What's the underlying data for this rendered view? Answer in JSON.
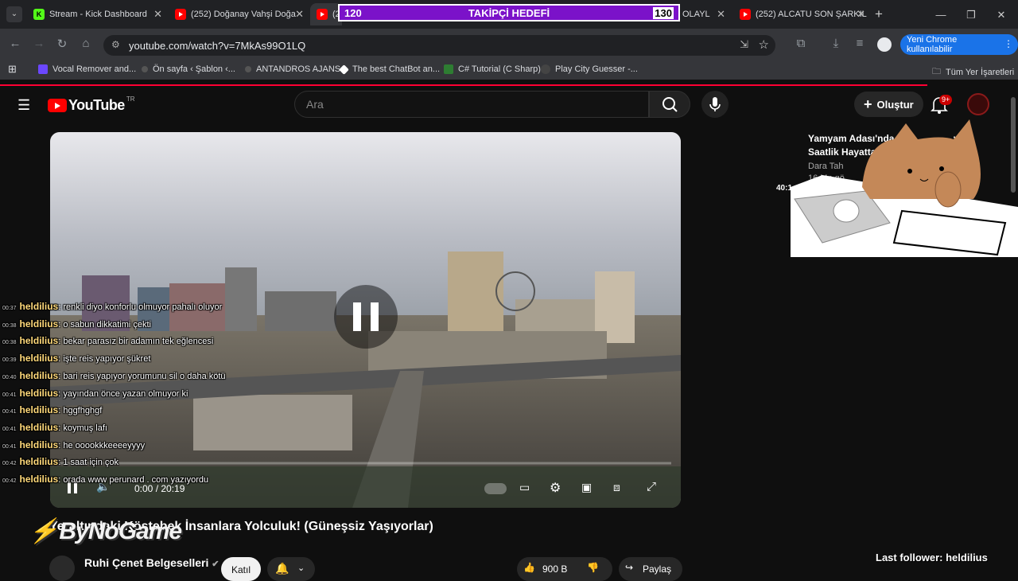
{
  "browser": {
    "tabs": [
      {
        "title": "Stream - Kick Dashboard",
        "icon": "kick-icon"
      },
      {
        "title": "(252) Doğanay Vahşi Doğa",
        "icon": "youtube-icon"
      },
      {
        "title": "(2",
        "icon": "youtube-icon",
        "active": true
      },
      {
        "title": "OLAYL",
        "icon": "youtube-icon"
      },
      {
        "title": "(252) ALCATU SON ŞARKIL",
        "icon": "youtube-icon"
      }
    ],
    "url": "youtube.com/watch?v=7MkAs99O1LQ",
    "profile_button": "Yeni Chrome kullanılabilir",
    "bookmarks": [
      "Vocal Remover and...",
      "Ön sayfa ‹ Şablon ‹...",
      "ANTANDROS AJANS",
      "The best ChatBot an...",
      "C# Tutorial (C Sharp)",
      "Play City Guesser -..."
    ],
    "all_bookmarks": "Tüm Yer İşaretleri"
  },
  "overlay_goal": {
    "label": "TAKİPÇİ HEDEFİ",
    "current": "120",
    "target": "130"
  },
  "youtube": {
    "logo_text": "YouTube",
    "region": "TR",
    "search_placeholder": "Ara",
    "create_label": "Oluştur",
    "notif_badge": "9+"
  },
  "player": {
    "time": "0:00 / 20:19",
    "progress": 0.0
  },
  "chat": [
    {
      "time": "00:37",
      "user": "heldilius",
      "msg": ": renkli diyo konforlu olmuyor pahalı oluyor"
    },
    {
      "time": "00:38",
      "user": "heldilius",
      "msg": ": o sabun dikkatimi çekti"
    },
    {
      "time": "00:38",
      "user": "heldilius",
      "msg": ": bekar parasız bir adamın tek eğlencesi"
    },
    {
      "time": "00:39",
      "user": "heldilius",
      "msg": ": işte reis yapıyor şükret"
    },
    {
      "time": "00:40",
      "user": "heldilius",
      "msg": ": bari reis yapıyor yorumunu sil o daha kötü"
    },
    {
      "time": "00:41",
      "user": "heldilius",
      "msg": ": yayından önce yazan olmuyor ki"
    },
    {
      "time": "00:41",
      "user": "heldilius",
      "msg": ": hggfhghgf"
    },
    {
      "time": "00:41",
      "user": "heldilius",
      "msg": ": koymuş lafı"
    },
    {
      "time": "00:41",
      "user": "heldilius",
      "msg": ": he ooookkkeeeeyyyy"
    },
    {
      "time": "00:42",
      "user": "heldilius",
      "msg": ": 1 saat için çok"
    },
    {
      "time": "00:42",
      "user": "heldilius",
      "msg": ": orada www perunard . com yazıyordu"
    }
  ],
  "recommendation": {
    "title": "Yamyam Adası'nda 24 Saatlik Hayatta Kalma",
    "channel": "Dara Tah",
    "meta": "16 Mn gö",
    "duration": "40:1"
  },
  "video": {
    "title": "Yeraltındaki Köstebek İnsanlara Yolculuk! (Güneşsiz Yaşıyorlar)",
    "channel": "Ruhi Çenet Belgeselleri",
    "join_label": "Katıl",
    "likes": "900 B",
    "share_label": "Paylaş"
  },
  "watermark": "ByNoGame",
  "last_follower": "Last follower: heldilius"
}
